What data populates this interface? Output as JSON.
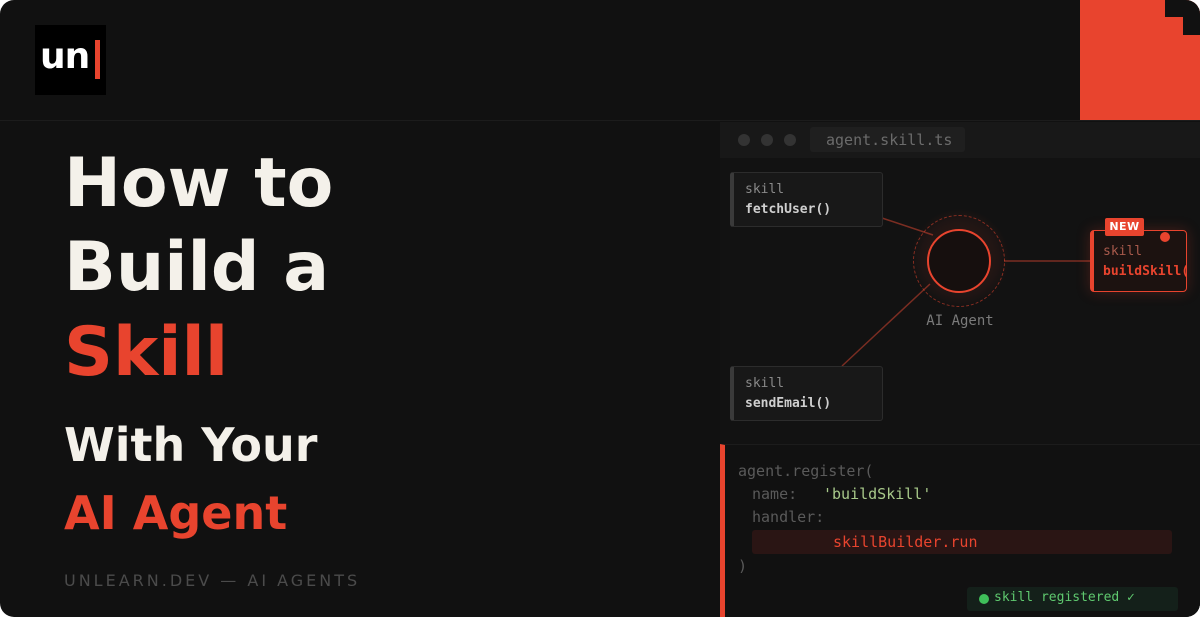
{
  "logo": {
    "text": "un"
  },
  "headline": {
    "line1": "How to",
    "line2": "Build a",
    "line3": "Skill",
    "line4": "With Your",
    "line5": "AI Agent"
  },
  "footer": "UNLEARN.DEV — AI AGENTS",
  "editor": {
    "filename": "agent.skill.ts",
    "nodes": [
      {
        "type": "skill",
        "fn": "fetchUser()"
      },
      {
        "type": "skill",
        "fn": "sendEmail()"
      },
      {
        "type": "skill",
        "fn": "buildSkill()",
        "badge": "NEW"
      }
    ],
    "agent_label": "AI Agent",
    "agent_icon": "",
    "code": {
      "line1": "agent.register(",
      "name_key": "name:",
      "name_value": "'buildSkill'",
      "handler_key": "handler:",
      "handler_value": "skillBuilder.run",
      "close": ")"
    },
    "status": "skill registered ✓"
  },
  "colors": {
    "accent": "#e8442e",
    "background": "#111111",
    "text": "#f4f1ea",
    "success": "#3fbf5a"
  }
}
